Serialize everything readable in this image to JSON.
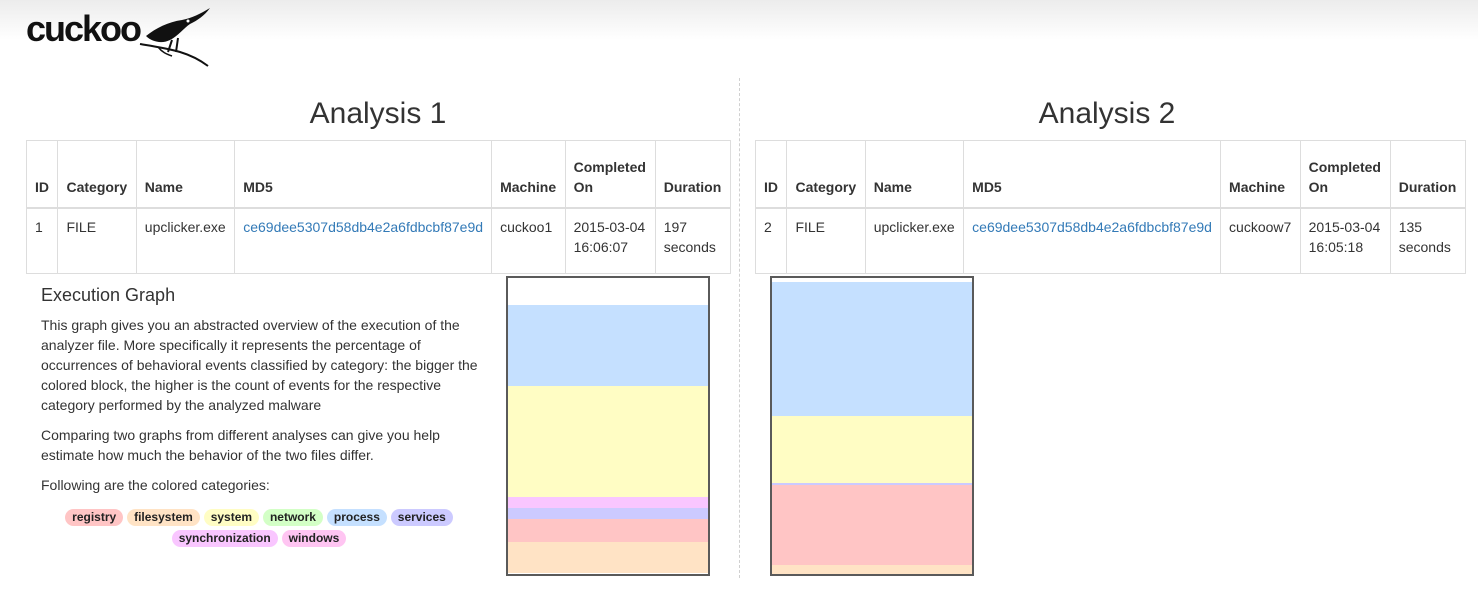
{
  "app": {
    "logo_text": "cuckoo"
  },
  "categories": [
    {
      "name": "registry",
      "color": "#ffc5c5"
    },
    {
      "name": "filesystem",
      "color": "#ffe3c5"
    },
    {
      "name": "system",
      "color": "#fffdc4"
    },
    {
      "name": "network",
      "color": "#d3ffc6"
    },
    {
      "name": "process",
      "color": "#c5e0ff"
    },
    {
      "name": "services",
      "color": "#cccaff"
    },
    {
      "name": "synchronization",
      "color": "#f9c6ff"
    },
    {
      "name": "windows",
      "color": "#ffc5f2"
    }
  ],
  "table_headers": {
    "id": "ID",
    "category": "Category",
    "name": "Name",
    "md5": "MD5",
    "machine": "Machine",
    "completed_line1": "Completed",
    "completed_line2": "On",
    "duration": "Duration"
  },
  "analyses": [
    {
      "title": "Analysis 1",
      "id": "1",
      "category": "FILE",
      "name": "upclicker.exe",
      "md5": "ce69dee5307d58db4e2a6fdbcbf87e9d",
      "machine": "cuckoo1",
      "completed_date": "2015-03-04",
      "completed_time": "16:06:07",
      "duration_value": "197",
      "duration_unit": "seconds",
      "graph_segments": [
        {
          "category": "none",
          "share": 0.092
        },
        {
          "category": "process",
          "share": 0.275
        },
        {
          "category": "system",
          "share": 0.375
        },
        {
          "category": "synchronization",
          "share": 0.037
        },
        {
          "category": "services",
          "share": 0.037
        },
        {
          "category": "registry",
          "share": 0.078
        },
        {
          "category": "filesystem",
          "share": 0.106
        }
      ]
    },
    {
      "title": "Analysis 2",
      "id": "2",
      "category": "FILE",
      "name": "upclicker.exe",
      "md5": "ce69dee5307d58db4e2a6fdbcbf87e9d",
      "machine": "cuckoow7",
      "completed_date": "2015-03-04",
      "completed_time": "16:05:18",
      "duration_value": "135",
      "duration_unit": "seconds",
      "graph_segments": [
        {
          "category": "none",
          "share": 0.014
        },
        {
          "category": "process",
          "share": 0.453
        },
        {
          "category": "system",
          "share": 0.226
        },
        {
          "category": "services",
          "share": 0.007
        },
        {
          "category": "registry",
          "share": 0.27
        },
        {
          "category": "filesystem",
          "share": 0.03
        }
      ]
    }
  ],
  "execution_graph": {
    "title": "Execution Graph",
    "paragraph1": "This graph gives you an abstracted overview of the execution of the analyzer file. More specifically it represents the percentage of occurrences of behavioral events classified by category: the bigger the colored block, the higher is the count of events for the respective category performed by the analyzed malware",
    "paragraph2": "Comparing two graphs from different analyses can give you help estimate how much the behavior of the two files differ.",
    "paragraph3": "Following are the colored categories:"
  }
}
